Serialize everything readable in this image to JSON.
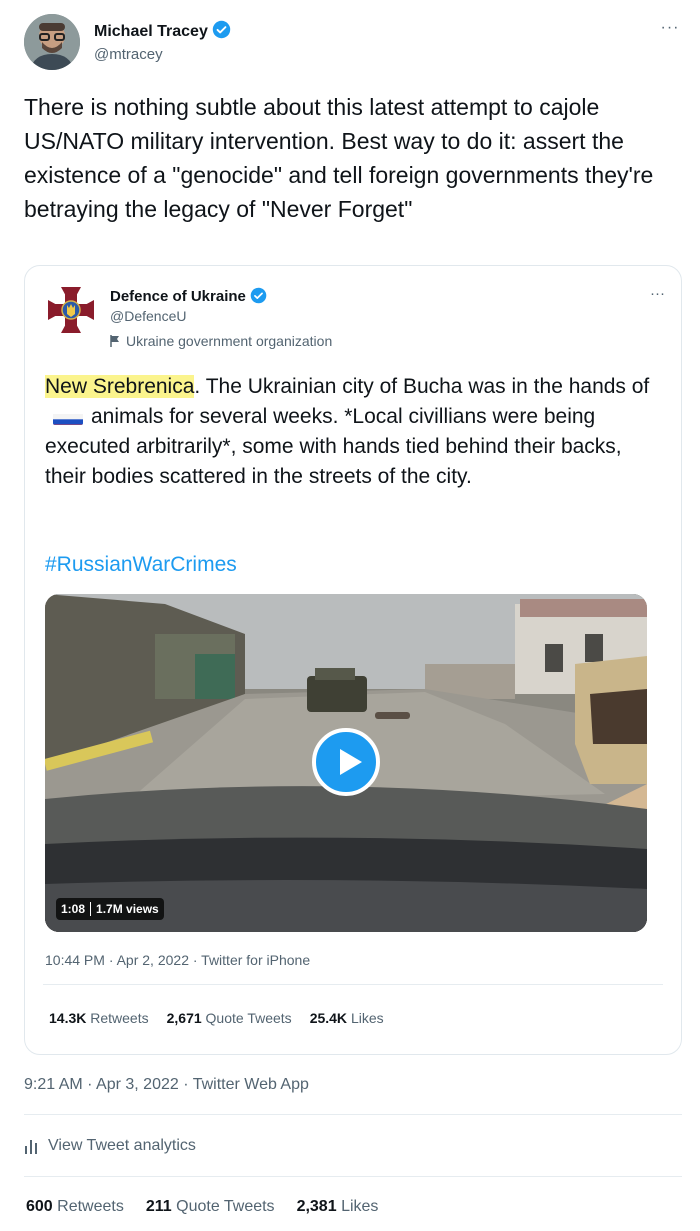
{
  "author": {
    "name": "Michael Tracey",
    "handle": "@mtracey"
  },
  "tweet_text": "There is nothing subtle about this latest attempt to cajole US/NATO military intervention. Best way to do it: assert the existence of a \"genocide\" and tell foreign governments they're betraying the legacy of \"Never Forget\"",
  "more_label": "···",
  "quoted": {
    "name": "Defence of Ukraine",
    "handle": "@DefenceU",
    "org_label": "Ukraine government organization",
    "highlight_text": "New Srebrenica",
    "text_part1": ". The Ukrainian city of Bucha was in the hands of",
    "text_part2": "animals for several weeks. *Local civillians were being executed arbitrarily*, some with hands tied behind their backs, their bodies scattered in the streets of the city.",
    "hashtag": "#RussianWarCrimes",
    "video": {
      "duration": "1:08",
      "views": "1.7M views"
    },
    "timestamp": "10:44 PM · Apr 2, 2022 · Twitter for iPhone",
    "stats": {
      "retweets_count": "14.3K",
      "retweets_label": "Retweets",
      "quotes_count": "2,671",
      "quotes_label": "Quote Tweets",
      "likes_count": "25.4K",
      "likes_label": "Likes"
    }
  },
  "timestamp": "9:21 AM · Apr 3, 2022 · Twitter Web App",
  "analytics_label": "View Tweet analytics",
  "stats": {
    "retweets_count": "600",
    "retweets_label": "Retweets",
    "quotes_count": "211",
    "quotes_label": "Quote Tweets",
    "likes_count": "2,381",
    "likes_label": "Likes"
  },
  "colors": {
    "accent": "#1d9bf0",
    "highlight": "#fbf48d",
    "secondary_text": "#536471"
  },
  "icons": [
    "verified-badge-icon",
    "more-icon",
    "flag-icon",
    "russia-flag-icon",
    "play-icon",
    "analytics-icon"
  ]
}
